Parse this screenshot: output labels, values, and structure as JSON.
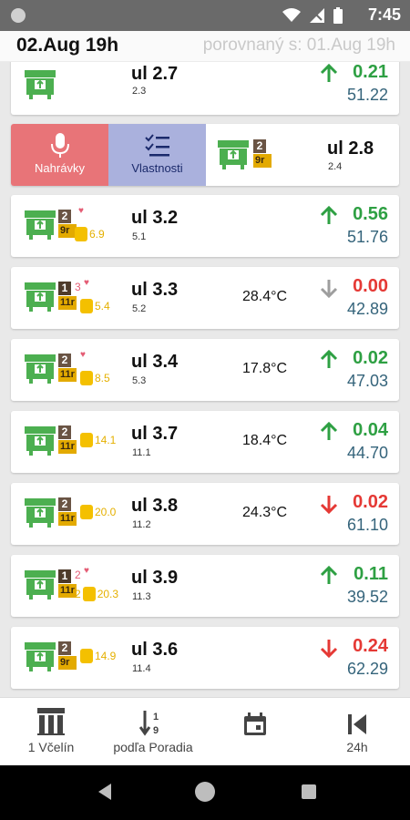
{
  "status": {
    "time": "7:45"
  },
  "header": {
    "date": "02.Aug 19h",
    "compare": "porovnaný s: 01.Aug 19h"
  },
  "colors": {
    "up": "#2ea043",
    "down": "#e53935",
    "neutral": "#9e9e9e",
    "total": "#35647b",
    "hive_green": "#4caf50",
    "record_red": "#e87478",
    "props_blue": "#aab1dd"
  },
  "swipe_actions": {
    "record_label": "Nahrávky",
    "properties_label": "Vlastnosti"
  },
  "hives": [
    {
      "name": "ul 2.7",
      "sub": "2.3",
      "temp": "",
      "trend": "up",
      "delta": "0.21",
      "total": "51.22",
      "badge_num": "",
      "badge_age": "",
      "hearts": "",
      "food": ""
    },
    {
      "name": "ul 2.8",
      "sub": "2.4",
      "temp": "",
      "trend": "",
      "delta": "",
      "total": "",
      "badge_num": "2",
      "badge_age": "9r",
      "hearts": "",
      "food": ""
    },
    {
      "name": "ul 3.2",
      "sub": "5.1",
      "temp": "",
      "trend": "up",
      "delta": "0.56",
      "total": "51.76",
      "badge_num": "2",
      "badge_age": "9r",
      "hearts": "",
      "food": "6.9"
    },
    {
      "name": "ul 3.3",
      "sub": "5.2",
      "temp": "28.4°C",
      "trend": "neutral",
      "delta": "0.00",
      "total": "42.89",
      "badge_num": "1",
      "badge_age": "11r",
      "hearts": "3",
      "food": "5.4"
    },
    {
      "name": "ul 3.4",
      "sub": "5.3",
      "temp": "17.8°C",
      "trend": "up",
      "delta": "0.02",
      "total": "47.03",
      "badge_num": "2",
      "badge_age": "11r",
      "hearts": "",
      "food": "8.5"
    },
    {
      "name": "ul 3.7",
      "sub": "11.1",
      "temp": "18.4°C",
      "trend": "up",
      "delta": "0.04",
      "total": "44.70",
      "badge_num": "2",
      "badge_age": "11r",
      "hearts": "",
      "food": "14.1"
    },
    {
      "name": "ul 3.8",
      "sub": "11.2",
      "temp": "24.3°C",
      "trend": "down",
      "delta": "0.02",
      "total": "61.10",
      "badge_num": "2",
      "badge_age": "11r",
      "hearts": "",
      "food": "20.0"
    },
    {
      "name": "ul 3.9",
      "sub": "11.3",
      "temp": "",
      "trend": "up",
      "delta": "0.11",
      "total": "39.52",
      "badge_num": "1",
      "badge_age": "11r",
      "hearts": "2",
      "food": "20.3",
      "food_count": "2"
    },
    {
      "name": "ul 3.6",
      "sub": "11.4",
      "temp": "",
      "trend": "down",
      "delta": "0.24",
      "total": "62.29",
      "badge_num": "2",
      "badge_age": "9r",
      "hearts": "",
      "food": "14.9"
    }
  ],
  "bottom_nav": [
    {
      "label": "1 Včelín",
      "icon": "apiary-icon"
    },
    {
      "label": "podľa Poradia",
      "icon": "sort-icon"
    },
    {
      "label": "",
      "icon": "calendar-icon"
    },
    {
      "label": "24h",
      "icon": "skip-back-icon"
    }
  ]
}
